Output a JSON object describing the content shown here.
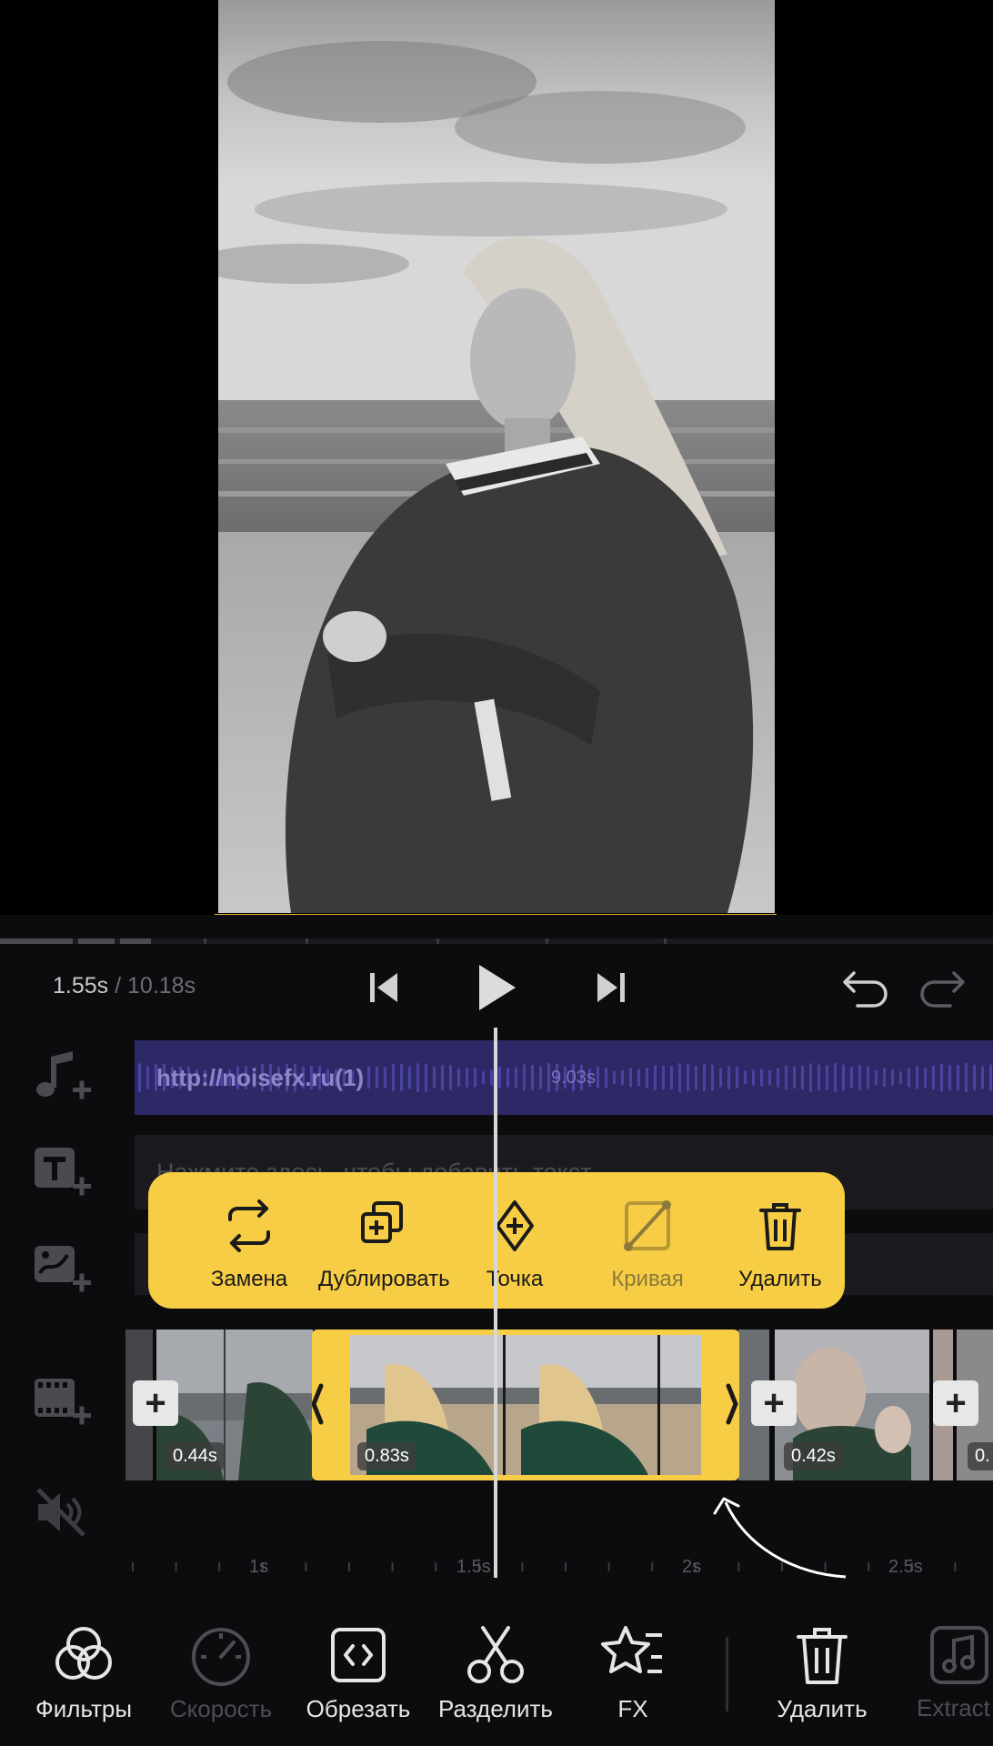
{
  "player": {
    "current_time": "1.55s",
    "total_time": "/ 10.18s"
  },
  "tracks": {
    "audio_label": "http://noisefx.ru(1)",
    "audio_duration": "9.03s",
    "text_placeholder": "Нажмите здесь, чтобы добавить текст"
  },
  "popup": {
    "items": [
      {
        "label": "Замена",
        "icon": "replace-icon",
        "enabled": true
      },
      {
        "label": "Дублировать",
        "icon": "duplicate-icon",
        "enabled": true
      },
      {
        "label": "Точка",
        "icon": "keyframe-point-icon",
        "enabled": true
      },
      {
        "label": "Кривая",
        "icon": "curve-icon",
        "enabled": false
      },
      {
        "label": "Удалить",
        "icon": "trash-icon",
        "enabled": true
      }
    ]
  },
  "clips": {
    "durations": [
      "0.44s",
      "0.83s",
      "0.42s",
      "0."
    ]
  },
  "ruler": {
    "labels": [
      "1s",
      "1.5s",
      "2s",
      "2.5s"
    ]
  },
  "toolbar": {
    "items": [
      {
        "label": "Фильтры",
        "icon": "filters-icon",
        "enabled": true
      },
      {
        "label": "Скорость",
        "icon": "speed-icon",
        "enabled": false
      },
      {
        "label": "Обрезать",
        "icon": "trim-icon",
        "enabled": true
      },
      {
        "label": "Разделить",
        "icon": "split-icon",
        "enabled": true
      },
      {
        "label": "FX",
        "icon": "fx-icon",
        "enabled": true
      },
      {
        "label": "Удалить",
        "icon": "trash-icon",
        "enabled": true
      },
      {
        "label": "Extract Audio",
        "icon": "extract-audio-icon",
        "enabled": false
      }
    ]
  },
  "colors": {
    "accent": "#f7cd45",
    "audio_track": "#2d2966",
    "background": "#0c0c0f"
  }
}
